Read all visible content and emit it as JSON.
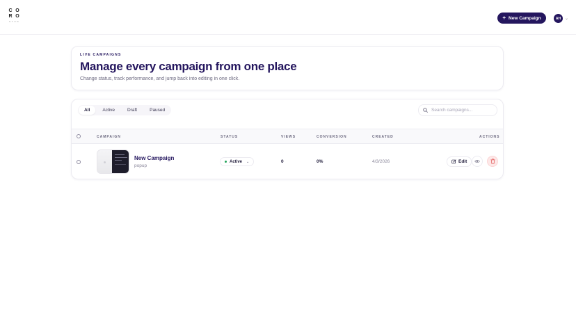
{
  "brand": {
    "logo_letters": [
      "C",
      "O",
      "R",
      "O"
    ],
    "logo_sub": "S T U D"
  },
  "header": {
    "new_campaign_label": "New Campaign",
    "avatar_initials": "AH"
  },
  "hero": {
    "eyebrow": "LIVE CAMPAIGNS",
    "title": "Manage every campaign from one place",
    "subtitle": "Change status, track performance, and jump back into editing in one click."
  },
  "filters": {
    "tabs": [
      {
        "label": "All",
        "active": true
      },
      {
        "label": "Active",
        "active": false
      },
      {
        "label": "Draft",
        "active": false
      },
      {
        "label": "Paused",
        "active": false
      }
    ],
    "search_placeholder": "Search campaigns..."
  },
  "table": {
    "columns": [
      "CAMPAIGN",
      "STATUS",
      "VIEWS",
      "CONVERSION",
      "CREATED",
      "ACTIONS"
    ],
    "rows": [
      {
        "name": "New Campaign",
        "type": "popup",
        "status": "Active",
        "views": "0",
        "conversion": "0%",
        "created": "4/3/2026",
        "edit_label": "Edit"
      }
    ]
  },
  "colors": {
    "brand": "#24165e",
    "active_dot": "#22a35a",
    "delete_bg": "#fde8e8",
    "delete_icon": "#e05252"
  },
  "icons": [
    "plus-icon",
    "chevron-down-icon",
    "search-icon",
    "edit-icon",
    "eye-icon",
    "trash-icon"
  ]
}
